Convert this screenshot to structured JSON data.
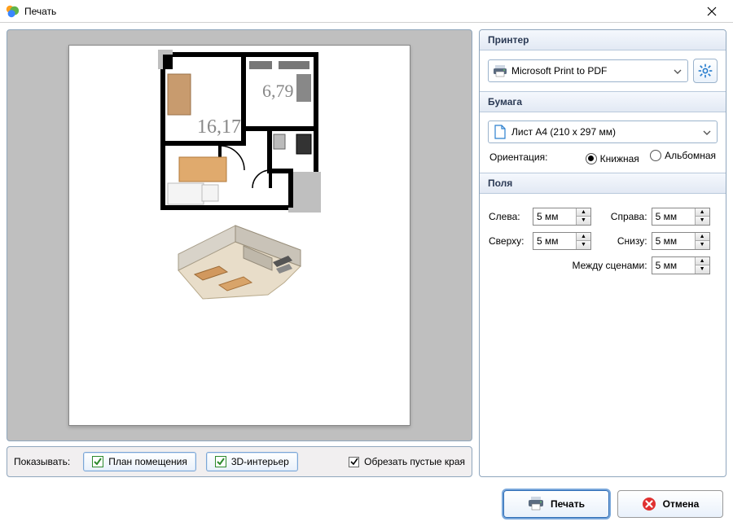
{
  "window": {
    "title": "Печать"
  },
  "preview": {
    "room1_area": "16,17",
    "room2_area": "6,79"
  },
  "bottom": {
    "show_label": "Показывать:",
    "plan_toggle": "План помещения",
    "iso_toggle": "3D-интерьер",
    "crop_label": "Обрезать пустые края",
    "crop_checked": true
  },
  "printer": {
    "section": "Принтер",
    "selected": "Microsoft Print to PDF"
  },
  "paper": {
    "section": "Бумага",
    "selected": "Лист A4 (210 x 297 мм)",
    "orientation_label": "Ориентация:",
    "portrait": "Книжная",
    "landscape": "Альбомная"
  },
  "margins": {
    "section": "Поля",
    "left_label": "Слева:",
    "right_label": "Справа:",
    "top_label": "Сверху:",
    "bottom_label": "Снизу:",
    "between_label": "Между сценами:",
    "left": "5 мм",
    "right": "5 мм",
    "top": "5 мм",
    "bottom": "5 мм",
    "between": "5 мм"
  },
  "footer": {
    "print": "Печать",
    "cancel": "Отмена"
  }
}
